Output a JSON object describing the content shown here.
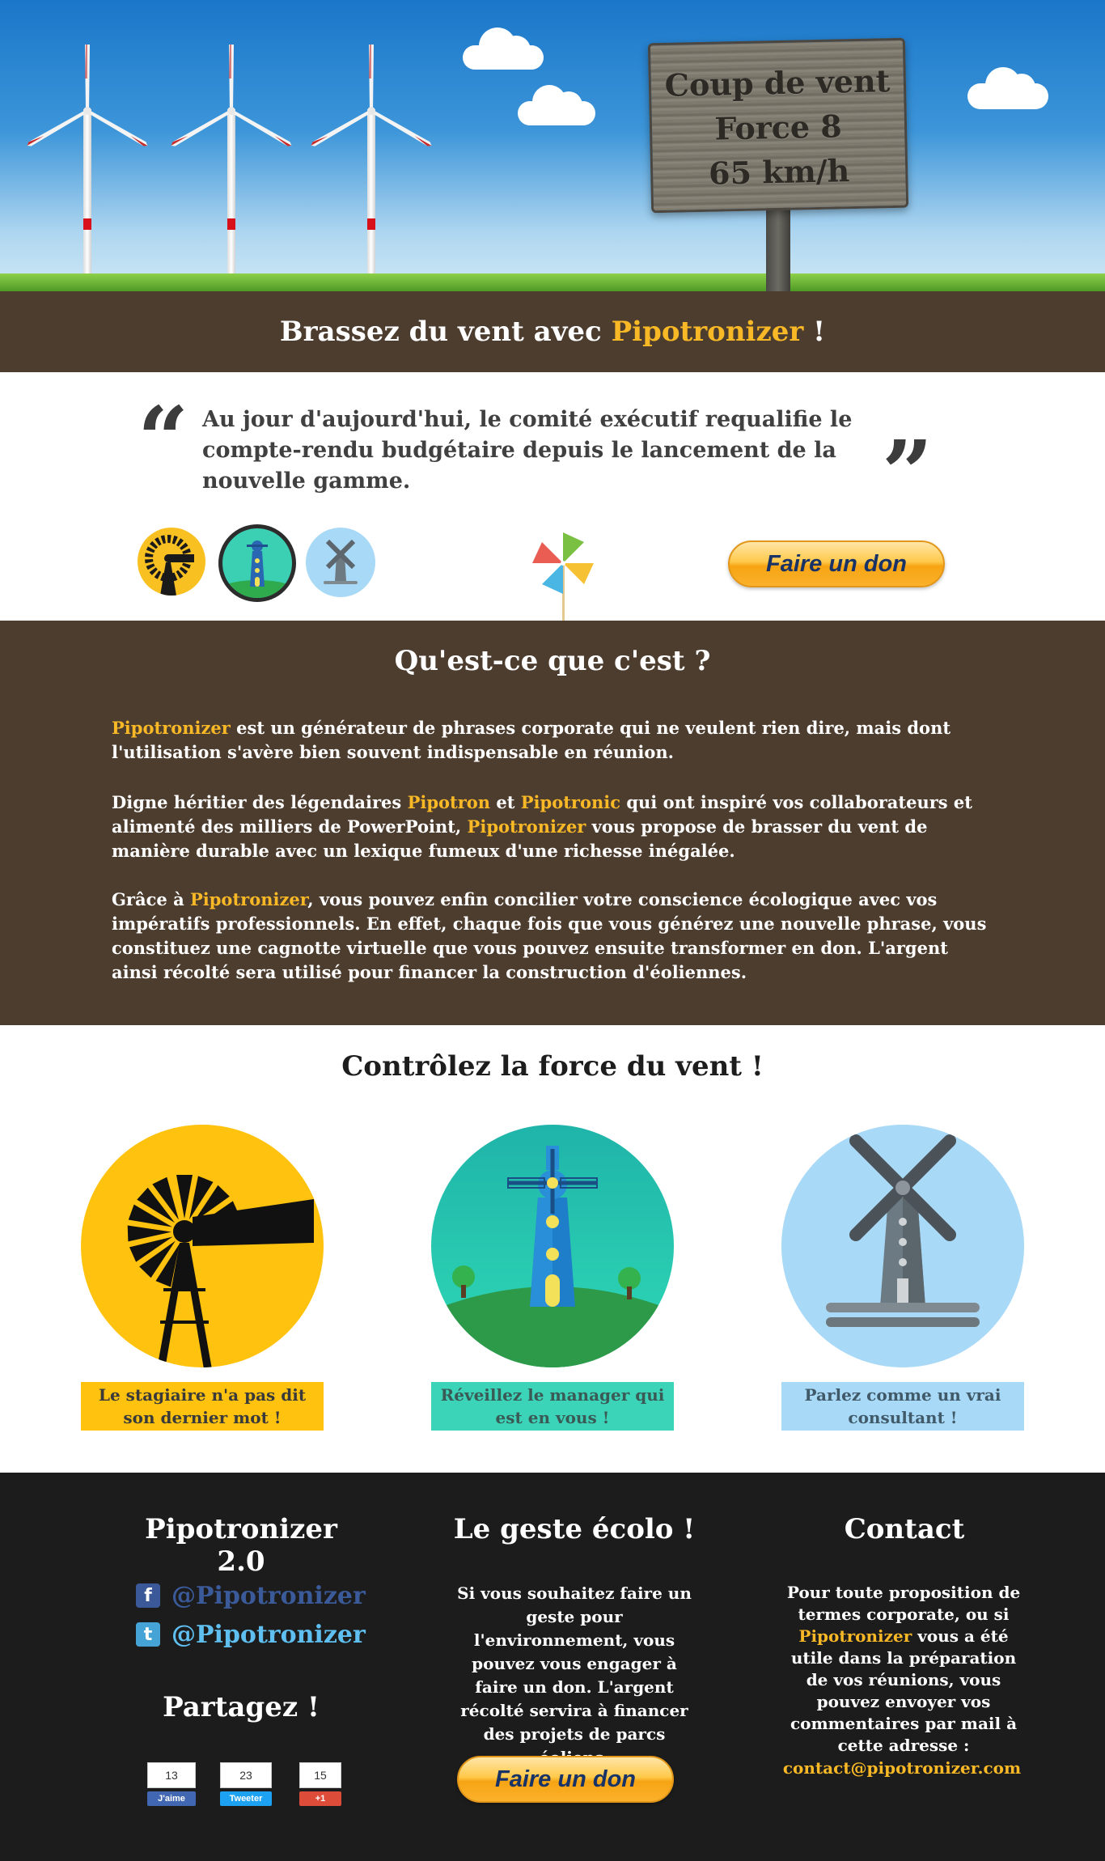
{
  "hero": {
    "sign_line1": "Coup de vent",
    "sign_line2": "Force 8",
    "sign_line3": "65 km/h"
  },
  "tagline": {
    "prefix": "Brassez du vent avec ",
    "brand": "Pipotronizer",
    "suffix": " !"
  },
  "quote": {
    "open_mark": "“",
    "text": "Au jour d'aujourd'hui, le comité exécutif requalifie le compte-rendu budgétaire depuis le lancement de la nouvelle gamme.",
    "close_mark": "”"
  },
  "donate": {
    "label": "Faire un don"
  },
  "what_is": {
    "title": "Qu'est-ce que c'est ?",
    "p1_brand": "Pipotronizer",
    "p1_rest": " est un générateur de phrases corporate qui ne veulent rien dire, mais dont l'utilisation s'avère bien souvent indispensable en réunion.",
    "p2_a": "Digne héritier des légendaires ",
    "p2_b": "Pipotron",
    "p2_c": " et ",
    "p2_d": "Pipotronic",
    "p2_e": " qui ont inspiré vos collaborateurs et alimenté des milliers de PowerPoint, ",
    "p2_f": "Pipotronizer",
    "p2_g": " vous propose de brasser du vent de manière durable avec un lexique fumeux d'une richesse inégalée.",
    "p3_a": "Grâce à ",
    "p3_b": "Pipotronizer",
    "p3_c": ", vous pouvez enfin concilier votre conscience écologique avec vos impératifs professionnels. En effet, chaque fois que vous générez une nouvelle phrase, vous constituez une cagnotte virtuelle que vous pouvez ensuite transformer en don. L'argent ainsi récolté sera utilisé pour financer la construction d'éoliennes."
  },
  "control": {
    "title": "Contrôlez la force du vent !",
    "options": [
      {
        "label": "Le stagiaire n'a pas dit son dernier mot !",
        "icon": "windpump-icon",
        "color": "#ffc20e"
      },
      {
        "label": "Réveillez le manager qui est en vous !",
        "icon": "lighthouse-windmill-icon",
        "color": "#3cd4b9"
      },
      {
        "label": "Parlez comme un vrai consultant !",
        "icon": "windmill-icon",
        "color": "#a8d9f6"
      }
    ]
  },
  "footer": {
    "col1_title": "Pipotronizer 2.0",
    "facebook": "@Pipotronizer",
    "twitter": "@Pipotronizer",
    "share_title": "Partagez !",
    "fb_count": "13",
    "fb_label": "J'aime",
    "tw_count": "23",
    "tw_label": "Tweeter",
    "gp_count": "15",
    "gp_label": "+1",
    "col2_title": "Le geste écolo !",
    "col2_text": "Si vous souhaitez faire un geste pour l'environnement, vous pouvez vous engager à faire un don. L'argent récolté servira à financer des projets de parcs éoliens.",
    "col3_title": "Contact",
    "col3_a": "Pour toute proposition de termes corporate, ou si ",
    "col3_brand": "Pipotronizer",
    "col3_b": " vous a été utile dans la préparation de vos réunions, vous pouvez envoyer vos commentaires par mail à cette adresse :",
    "email": "contact@pipotronizer.com"
  },
  "colors": {
    "brown": "#4d3d2f",
    "accent": "#f9b826",
    "footer": "#1c1c1c"
  }
}
